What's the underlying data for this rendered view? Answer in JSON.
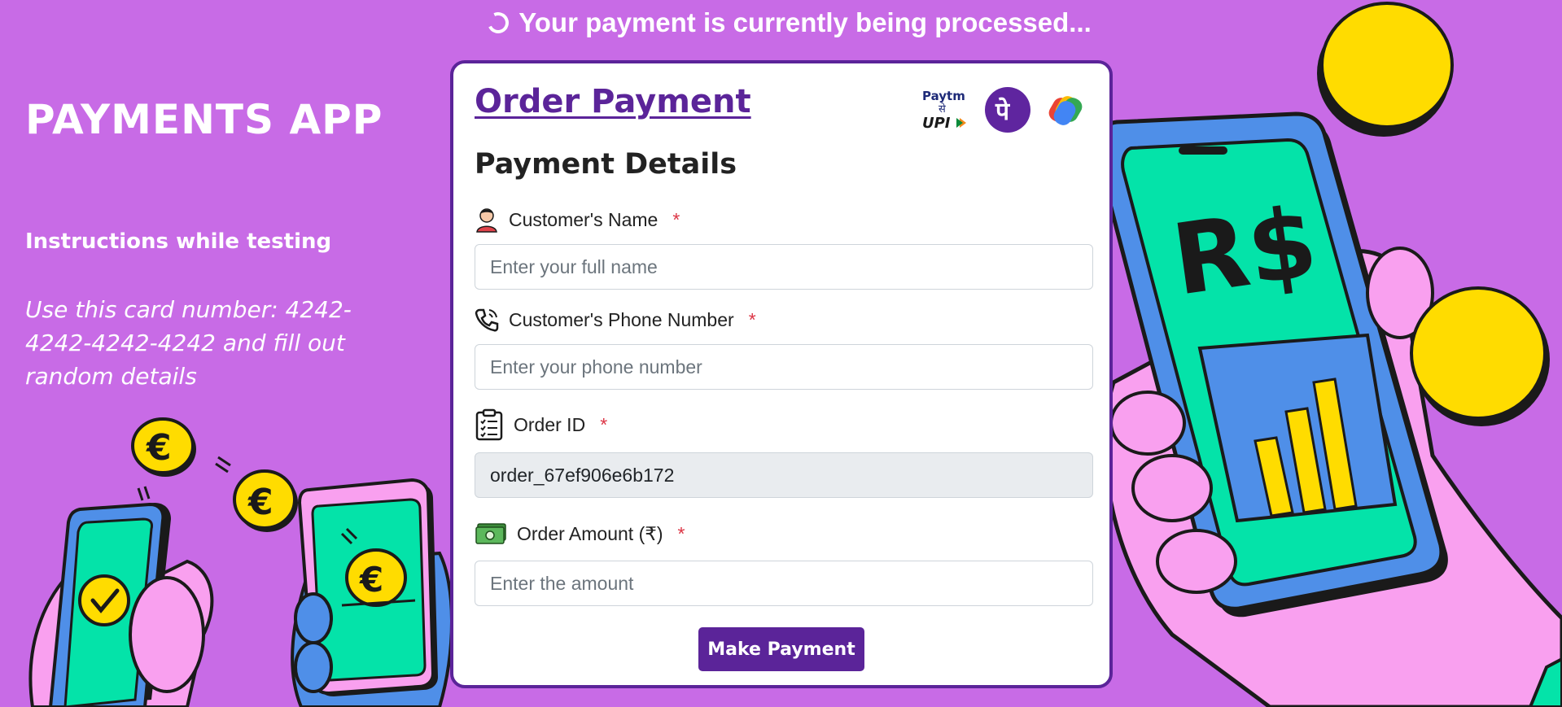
{
  "status": {
    "text": "Your payment is currently being processed...",
    "icon": "spinner-icon"
  },
  "sidebar": {
    "brand": "PAYMENTS APP",
    "instructions_title": "Instructions while testing",
    "instructions_body": "Use this card number: 4242-4242-4242-4242 and fill out random details"
  },
  "card": {
    "title": "Order Payment",
    "subtitle": "Payment Details",
    "logos": {
      "paytm_top": "Paytm",
      "paytm_mid": "से",
      "paytm_bottom": "UPI",
      "phonepe": "पे"
    },
    "fields": {
      "name": {
        "label": "Customer's Name",
        "required": "*",
        "placeholder": "Enter your full name",
        "icon": "person-icon"
      },
      "phone": {
        "label": "Customer's Phone Number",
        "required": "*",
        "placeholder": "Enter your phone number",
        "icon": "phone-icon"
      },
      "order": {
        "label": "Order ID",
        "required": "*",
        "value": "order_67ef906e6b172",
        "icon": "clipboard-icon"
      },
      "amount": {
        "label": "Order Amount (₹)",
        "required": "*",
        "placeholder": "Enter the amount",
        "icon": "cash-icon"
      }
    },
    "button": "Make Payment"
  },
  "illustration": {
    "big_phone_text": "R$",
    "euro_symbol": "€"
  },
  "colors": {
    "background": "#c86be6",
    "accent": "#5b2499",
    "required": "#dc3545",
    "phone_screen": "#04e3a9",
    "coin": "#ffdc00"
  }
}
